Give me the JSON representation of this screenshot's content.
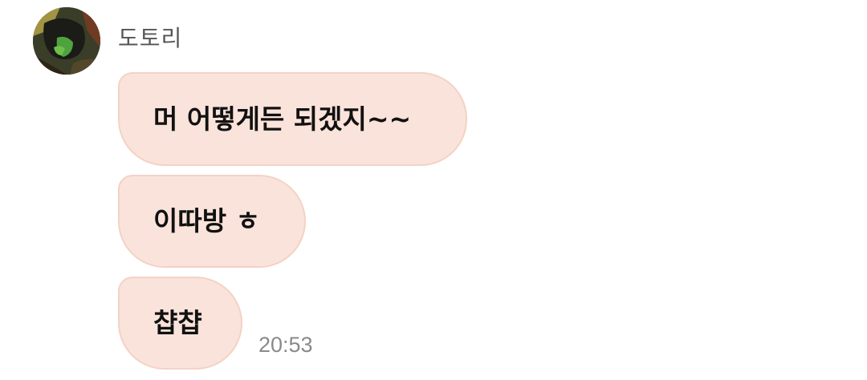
{
  "chat": {
    "sender": {
      "name": "도토리",
      "avatar_icon": "profile-avatar"
    },
    "messages": [
      {
        "text": "머 어떻게든 되겠지~~"
      },
      {
        "text": "이따방 ㅎ"
      },
      {
        "text": "챱챱"
      }
    ],
    "timestamp": "20:53"
  },
  "colors": {
    "bubble_bg": "#fae3da",
    "bubble_border": "#f3d2c5",
    "name_text": "#555555",
    "time_text": "#8a8a8a"
  }
}
